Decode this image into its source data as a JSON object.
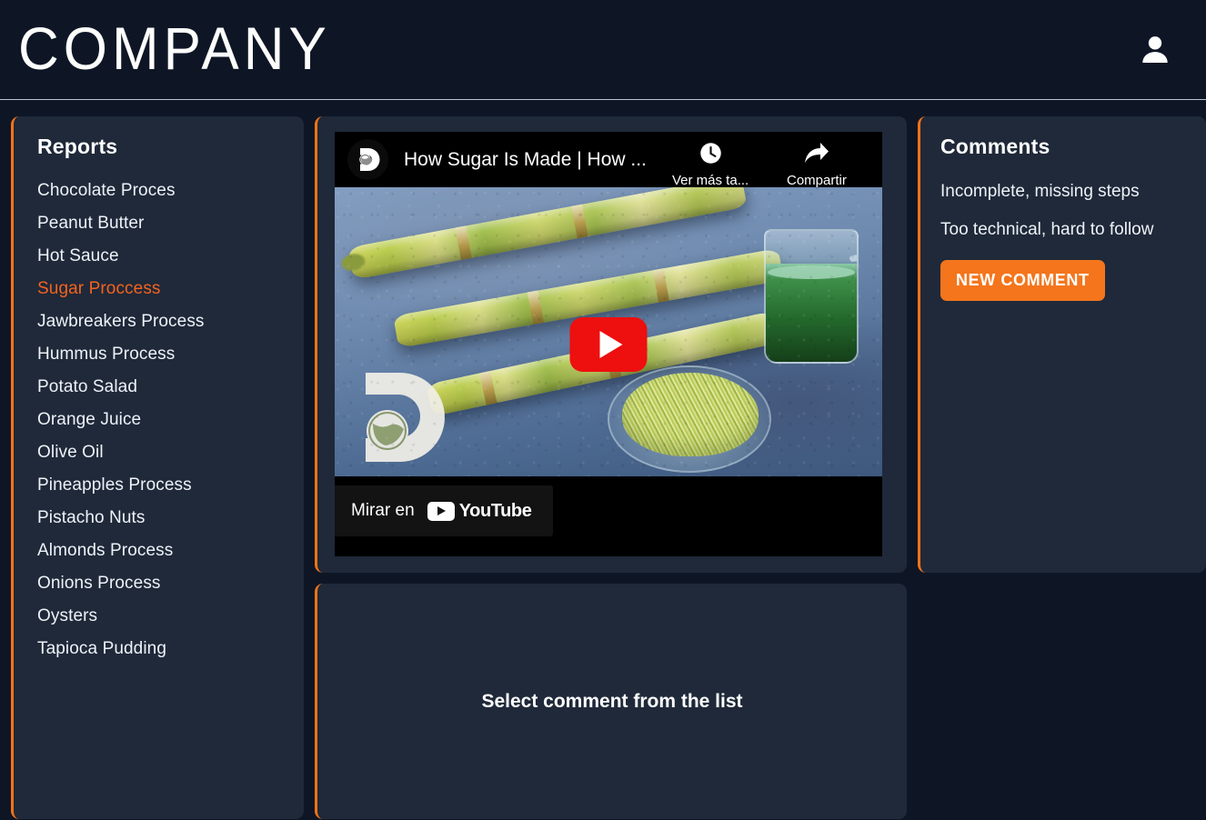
{
  "header": {
    "brand": "COMPANY",
    "avatar_icon": "user-icon"
  },
  "sidebar": {
    "title": "Reports",
    "active_item": "Sugar Proccess",
    "items": [
      {
        "label": "Chocolate Proces"
      },
      {
        "label": "Peanut Butter"
      },
      {
        "label": "Hot Sauce"
      },
      {
        "label": "Sugar Proccess"
      },
      {
        "label": "Jawbreakers Process"
      },
      {
        "label": "Hummus Process"
      },
      {
        "label": "Potato Salad"
      },
      {
        "label": "Orange Juice"
      },
      {
        "label": "Olive Oil"
      },
      {
        "label": "Pineapples Process"
      },
      {
        "label": "Pistacho Nuts"
      },
      {
        "label": "Almonds Process"
      },
      {
        "label": "Onions Process"
      },
      {
        "label": "Oysters"
      },
      {
        "label": "Tapioca Pudding"
      }
    ]
  },
  "video": {
    "channel_avatar_icon": "discovery-logo-icon",
    "title": "How Sugar Is Made | How ...",
    "watch_later": {
      "icon": "clock-icon",
      "label": "Ver más ta..."
    },
    "share": {
      "icon": "share-arrow-icon",
      "label": "Compartir"
    },
    "play_button_icon": "play-icon",
    "watch_on": {
      "label": "Mirar en",
      "platform": "YouTube",
      "icon": "youtube-icon"
    },
    "watermark_icon": "discovery-watermark-icon"
  },
  "comments": {
    "title": "Comments",
    "items": [
      {
        "text": "Incomplete, missing steps"
      },
      {
        "text": "Too technical, hard to follow"
      }
    ],
    "new_comment_label": "NEW COMMENT"
  },
  "detail": {
    "placeholder": "Select comment from the list"
  },
  "colors": {
    "page_background": "#0e1626",
    "panel_background": "#1f2939",
    "accent_orange": "#f97316",
    "active_item": "#f4621f",
    "button_orange": "#f4751c",
    "text_primary": "#eef2f8",
    "youtube_red": "#ee0f0f"
  }
}
